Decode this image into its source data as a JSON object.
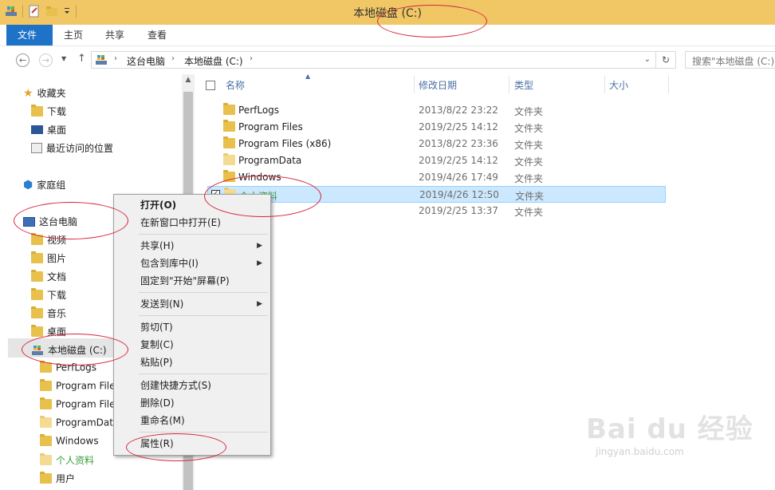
{
  "window": {
    "title": "本地磁盘 (C:)"
  },
  "ribbon": {
    "tabs": [
      "文件",
      "主页",
      "共享",
      "查看"
    ]
  },
  "address": {
    "crumbs": [
      "这台电脑",
      "本地磁盘 (C:)"
    ],
    "search_placeholder": "搜索\"本地磁盘 (C:)\""
  },
  "nav": {
    "favorites": "收藏夹",
    "fav_items": [
      "下载",
      "桌面",
      "最近访问的位置"
    ],
    "homegroup": "家庭组",
    "thispc": "这台电脑",
    "pc_items": [
      "视频",
      "图片",
      "文档",
      "下载",
      "音乐",
      "桌面"
    ],
    "drive": "本地磁盘 (C:)",
    "drive_items": [
      "PerfLogs",
      "Program File",
      "Program File",
      "ProgramDat",
      "Windows",
      "个人资料",
      "用户"
    ]
  },
  "columns": {
    "name": "名称",
    "date": "修改日期",
    "type": "类型",
    "size": "大小"
  },
  "files": [
    {
      "name": "PerfLogs",
      "date": "2013/8/22 23:22",
      "type": "文件夹"
    },
    {
      "name": "Program Files",
      "date": "2019/2/25 14:12",
      "type": "文件夹"
    },
    {
      "name": "Program Files (x86)",
      "date": "2013/8/22 23:36",
      "type": "文件夹"
    },
    {
      "name": "ProgramData",
      "date": "2019/2/25 14:12",
      "type": "文件夹"
    },
    {
      "name": "Windows",
      "date": "2019/4/26 17:49",
      "type": "文件夹"
    },
    {
      "name": "个人资料",
      "date": "2019/4/26 12:50",
      "type": "文件夹"
    },
    {
      "name": "",
      "date": "2019/2/25 13:37",
      "type": "文件夹"
    }
  ],
  "context_menu": {
    "open": "打开(O)",
    "open_new": "在新窗口中打开(E)",
    "share": "共享(H)",
    "include": "包含到库中(I)",
    "pin": "固定到\"开始\"屏幕(P)",
    "sendto": "发送到(N)",
    "cut": "剪切(T)",
    "copy": "复制(C)",
    "paste": "粘贴(P)",
    "shortcut": "创建快捷方式(S)",
    "delete": "删除(D)",
    "rename": "重命名(M)",
    "properties": "属性(R)"
  },
  "watermark": {
    "brand": "Bai du 经验",
    "url": "jingyan.baidu.com"
  },
  "colors": {
    "accent": "#1e72c8",
    "title_bar": "#f1c766",
    "annotation": "#d6263a",
    "selection": "#cce8ff"
  }
}
